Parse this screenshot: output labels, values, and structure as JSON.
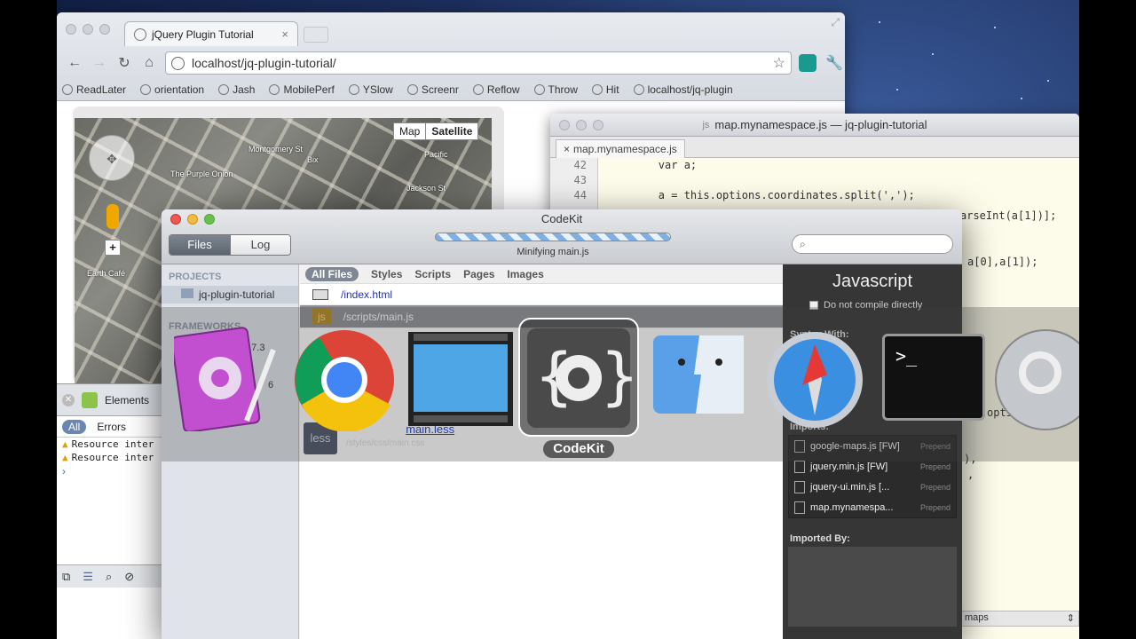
{
  "chrome": {
    "tab_title": "jQuery Plugin Tutorial",
    "tab_close": "×",
    "url": "localhost/jq-plugin-tutorial/",
    "bookmarks": [
      "ReadLater",
      "orientation",
      "Jash",
      "MobilePerf",
      "YSlow",
      "Screenr",
      "Reflow",
      "Throw",
      "Hit",
      "localhost/jq-plugin"
    ],
    "map_types": [
      "Map",
      "Satellite"
    ],
    "map_labels": [
      "The Purple Onion",
      "Bix",
      "Jackson St",
      "Montgomery St",
      "Pacific",
      "Earth Café"
    ]
  },
  "devtools": {
    "panel": "Elements",
    "filters": [
      "All",
      "Errors"
    ],
    "log_lines": [
      "Resource inter",
      "Resource inter"
    ],
    "prompt": "›"
  },
  "editor": {
    "window_title": "map.mynamespace.js — jq-plugin-tutorial",
    "file_badge": "js",
    "tab": "map.mynamespace.js",
    "line_numbers": [
      "42",
      "43",
      "44"
    ],
    "code_lines": [
      "        var a;",
      "",
      "        a = this.options.coordinates.split(',');"
    ],
    "code_fragments": [
      "arseInt(a[1])];",
      "a[0],a[1]);",
      "opti",
      "),",
      ","
    ],
    "status": "maps"
  },
  "codekit": {
    "title": "CodeKit",
    "segments": [
      "Files",
      "Log"
    ],
    "status": "Minifying main.js",
    "search_placeholder": "",
    "sidebar": {
      "projects_header": "PROJECTS",
      "project": "jq-plugin-tutorial",
      "frameworks_header": "FRAMEWORKS",
      "framework_versions": [
        "3.7.3",
        "6"
      ]
    },
    "filters": [
      "All Files",
      "Styles",
      "Scripts",
      "Pages",
      "Images"
    ],
    "files": [
      {
        "name": "/index.html"
      },
      {
        "name": "/scripts/main.js",
        "prefix": "/scripts/",
        "base": "main.js",
        "badge": "js",
        "sub": "/scripts/min/m"
      }
    ],
    "less_file": {
      "badge": "less",
      "path": "/styles/less/",
      "base": "main.less",
      "sub": "/styles/css/main.css"
    },
    "inspector": {
      "title": "Javascript",
      "checkbox": "Do not compile directly",
      "syntax_label": "Syntax With:",
      "imports_header": "Imports:",
      "imports": [
        {
          "name": "google-maps.js [FW]",
          "tag": "Prepend"
        },
        {
          "name": "jquery.min.js [FW]",
          "tag": "Prepend"
        },
        {
          "name": "jquery-ui.min.js [...",
          "tag": "Prepend"
        },
        {
          "name": "map.mynamespa...",
          "tag": "Prepend"
        }
      ],
      "imported_by_header": "Imported By:"
    }
  },
  "switcher": {
    "apps": [
      "Script Editor",
      "Google Chrome",
      "Screen Recording",
      "CodeKit",
      "Finder",
      "Safari",
      "Terminal",
      "Sequel Pro"
    ],
    "selected_label": "CodeKit",
    "terminal_glyph": ">_"
  }
}
